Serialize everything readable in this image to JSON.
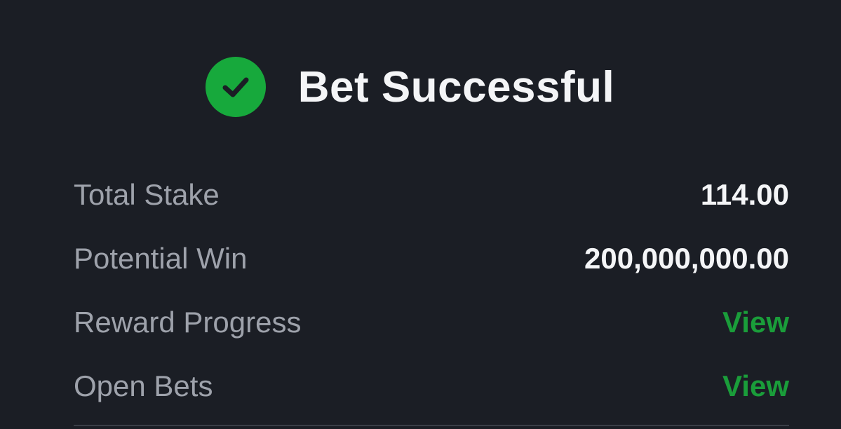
{
  "header": {
    "title": "Bet Successful",
    "icon": "check-circle-icon",
    "icon_color": "#17a93c"
  },
  "summary": {
    "rows": [
      {
        "label": "Total Stake",
        "value": "114.00"
      },
      {
        "label": "Potential Win",
        "value": "200,000,000.00"
      },
      {
        "label": "Reward Progress",
        "link": "View"
      },
      {
        "label": "Open Bets",
        "link": "View"
      }
    ]
  },
  "colors": {
    "background": "#1b1e25",
    "label": "#9ea2ab",
    "value": "#f4f5f7",
    "link": "#1a9d3a"
  }
}
